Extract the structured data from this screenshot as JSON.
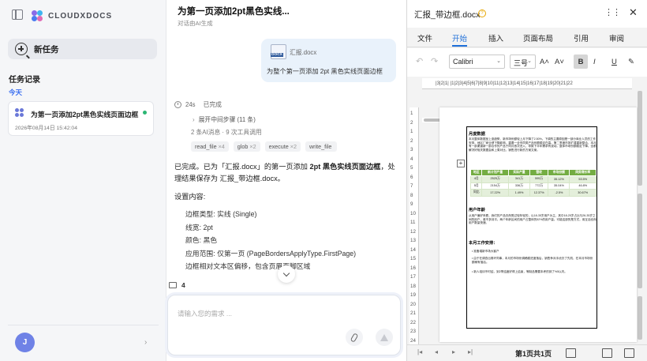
{
  "sidebar": {
    "brand": "CLOUDXDOCS",
    "new_task": "新任务",
    "history_title": "任务记录",
    "today_label": "今天",
    "task": {
      "title": "为第一页添加2pt黑色实线页面边框",
      "time": "2026年08月14日 15:42:04"
    },
    "user_initial": "J"
  },
  "chat": {
    "title": "为第一页添加2pt黑色实线...",
    "subtitle": "对话由AI生成",
    "attachment_name": "汇报.docx",
    "attachment_badge": "DOCX",
    "user_message": "为整个第一页添加 2pt 黑色实线页面边框",
    "duration": "24s",
    "status": "已完成",
    "steps_toggle": "展开中间步骤 (11 条)",
    "step_info": "2 条AI消息 · 9 次工具调用",
    "tools": [
      {
        "name": "read_file",
        "count": "×4"
      },
      {
        "name": "glob",
        "count": "×2"
      },
      {
        "name": "execute",
        "count": "×2"
      },
      {
        "name": "write_file",
        "count": ""
      }
    ],
    "answer_pre": "已完成。已为「汇报.docx」的第一页添加 ",
    "answer_bold": "2pt 黑色实线页面边框",
    "answer_post": "，处理结果保存为 汇报_带边框.docx。",
    "settings_title": "设置内容:",
    "settings": [
      "边框类型: 实线 (Single)",
      "线宽: 2pt",
      "颜色: 黑色",
      "应用范围: 仅第一页 (PageBordersApplyType.FirstPage)",
      "边框相对文本区偏移，包含页眉页脚区域"
    ],
    "file_count": "4",
    "input_placeholder": "请输入您的需求 ..."
  },
  "viewer": {
    "title": "汇报_带边框.docx",
    "more": "⋮⋮",
    "close": "✕",
    "tabs": [
      "文件",
      "开始",
      "插入",
      "页面布局",
      "引用",
      "审阅"
    ],
    "active_tab": "开始",
    "font": "Calibri",
    "font_size": "三号",
    "ruler_h": "|3|2|1| |1|2|3|4|5|6|7|8|9|10|11|12|13|14|15|16|17|18|19|20|21|22",
    "ruler_v": [
      "1",
      "2",
      "1",
      "2",
      "3",
      "4",
      "5",
      "6",
      "7",
      "8",
      "9",
      "10",
      "11",
      "12",
      "13",
      "14",
      "15",
      "16",
      "17",
      "18",
      "19",
      "20",
      "21",
      "22",
      "23",
      "24"
    ],
    "doc": {
      "h1": "月度数据",
      "p1": "本月整体数据呈上涨趋势，新市场份额较上月下降了2.50%。下调的主要原因是一部分商业人员的工作安排，地区厂家业绩下降影响，重要一全市同类产品份额稳定在高。第二季度市场扩建重新整合，本月有一部渠道新一部合作的产品于同月首次进入，导致下半年需求有波动。整体市场份额稳定下降。全都解决好相关数据会和上周对比，销售进行新的方案文案。",
      "table_head": [
        "地区",
        "新计划产量",
        "实际产量",
        "营收",
        "市场份额",
        "同类增长率"
      ],
      "table_rows": [
        [
          "4月",
          "2525万",
          "341万",
          "595万",
          "35.12%",
          "53.5%"
        ],
        [
          "5月",
          "2154万",
          "336万",
          "772万",
          "35.04%",
          "46.8%"
        ],
        [
          "同比",
          "17.22%",
          "1.49%",
          "12.37%",
          "-2.5%",
          "30.67%"
        ]
      ],
      "h2": "用户年龄",
      "p2": "从用户偏好来看，我们的产品仍然受过较年轻的，以18-35岁用户为主，其中18-25岁占比与26-35岁之间的用户，差不多持平。两个年龄区间的用户占整体的52%的用户量。可能这部的是方式，用互话也而用户数量快速。",
      "h3": "本月工作安排：",
      "bullets": [
        "准备增新市场大客户",
        "由于在调查出角环同事，本月的市场份调稿稳进度落后，销售争对手优仍了先机，在本月市场份额稍有落后。",
        "新人培训不时结，到2季结度好得上结束，等制品需要本考的到了%5以内。"
      ]
    },
    "page_info": "第1页共1页"
  },
  "colors": {
    "accent": "#3a6ef0",
    "word_blue": "#1f6fd9",
    "table_green": "#74ad43",
    "avatar": "#6f82e6",
    "status_green": "#2bb673"
  }
}
